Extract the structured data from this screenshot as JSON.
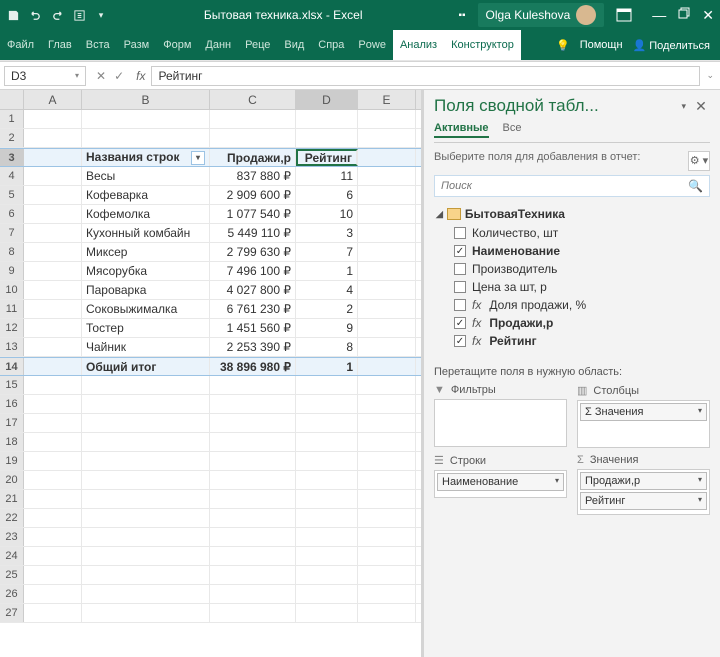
{
  "titlebar": {
    "filename": "Бытовая техника.xlsx  -  Excel",
    "user": "Olga Kuleshova"
  },
  "ribbon": {
    "tabs": [
      "Файл",
      "Глав",
      "Вста",
      "Разм",
      "Форм",
      "Данн",
      "Реце",
      "Вид",
      "Спра",
      "Powe",
      "Анализ",
      "Конструктор"
    ],
    "help": "Помощн",
    "share": "Поделиться"
  },
  "formula_bar": {
    "cell_ref": "D3",
    "formula": "Рейтинг"
  },
  "grid": {
    "cols": [
      "A",
      "B",
      "C",
      "D",
      "E"
    ],
    "headers": {
      "rowlabels": "Названия строк",
      "sales": "Продажи,р",
      "rank": "Рейтинг"
    },
    "rows": [
      {
        "name": "Весы",
        "sales": "837 880 ₽",
        "rank": "11"
      },
      {
        "name": "Кофеварка",
        "sales": "2 909 600 ₽",
        "rank": "6"
      },
      {
        "name": "Кофемолка",
        "sales": "1 077 540 ₽",
        "rank": "10"
      },
      {
        "name": "Кухонный комбайн",
        "sales": "5 449 110 ₽",
        "rank": "3"
      },
      {
        "name": "Миксер",
        "sales": "2 799 630 ₽",
        "rank": "7"
      },
      {
        "name": "Мясорубка",
        "sales": "7 496 100 ₽",
        "rank": "1"
      },
      {
        "name": "Пароварка",
        "sales": "4 027 800 ₽",
        "rank": "4"
      },
      {
        "name": "Соковыжималка",
        "sales": "6 761 230 ₽",
        "rank": "2"
      },
      {
        "name": "Тостер",
        "sales": "1 451 560 ₽",
        "rank": "9"
      },
      {
        "name": "Чайник",
        "sales": "2 253 390 ₽",
        "rank": "8"
      }
    ],
    "total": {
      "label": "Общий итог",
      "sales": "38 896 980 ₽",
      "rank": "1"
    }
  },
  "pane": {
    "title": "Поля сводной табл...",
    "tabs": {
      "active": "Активные",
      "all": "Все"
    },
    "subtitle": "Выберите поля для добавления в отчет:",
    "search_placeholder": "Поиск",
    "table_name": "БытоваяТехника",
    "fields": [
      {
        "label": "Количество, шт",
        "checked": false,
        "fx": false,
        "bold": false
      },
      {
        "label": "Наименование",
        "checked": true,
        "fx": false,
        "bold": true
      },
      {
        "label": "Производитель",
        "checked": false,
        "fx": false,
        "bold": false
      },
      {
        "label": "Цена за шт, р",
        "checked": false,
        "fx": false,
        "bold": false
      },
      {
        "label": "Доля продажи, %",
        "checked": false,
        "fx": true,
        "bold": false
      },
      {
        "label": "Продажи,р",
        "checked": true,
        "fx": true,
        "bold": true
      },
      {
        "label": "Рейтинг",
        "checked": true,
        "fx": true,
        "bold": true
      }
    ],
    "drag_label": "Перетащите поля в нужную область:",
    "zones": {
      "filters": "Фильтры",
      "columns": "Столбцы",
      "rows": "Строки",
      "values": "Значения",
      "columns_item": "Σ  Значения",
      "rows_item": "Наименование",
      "values_items": [
        "Продажи,р",
        "Рейтинг"
      ]
    }
  }
}
